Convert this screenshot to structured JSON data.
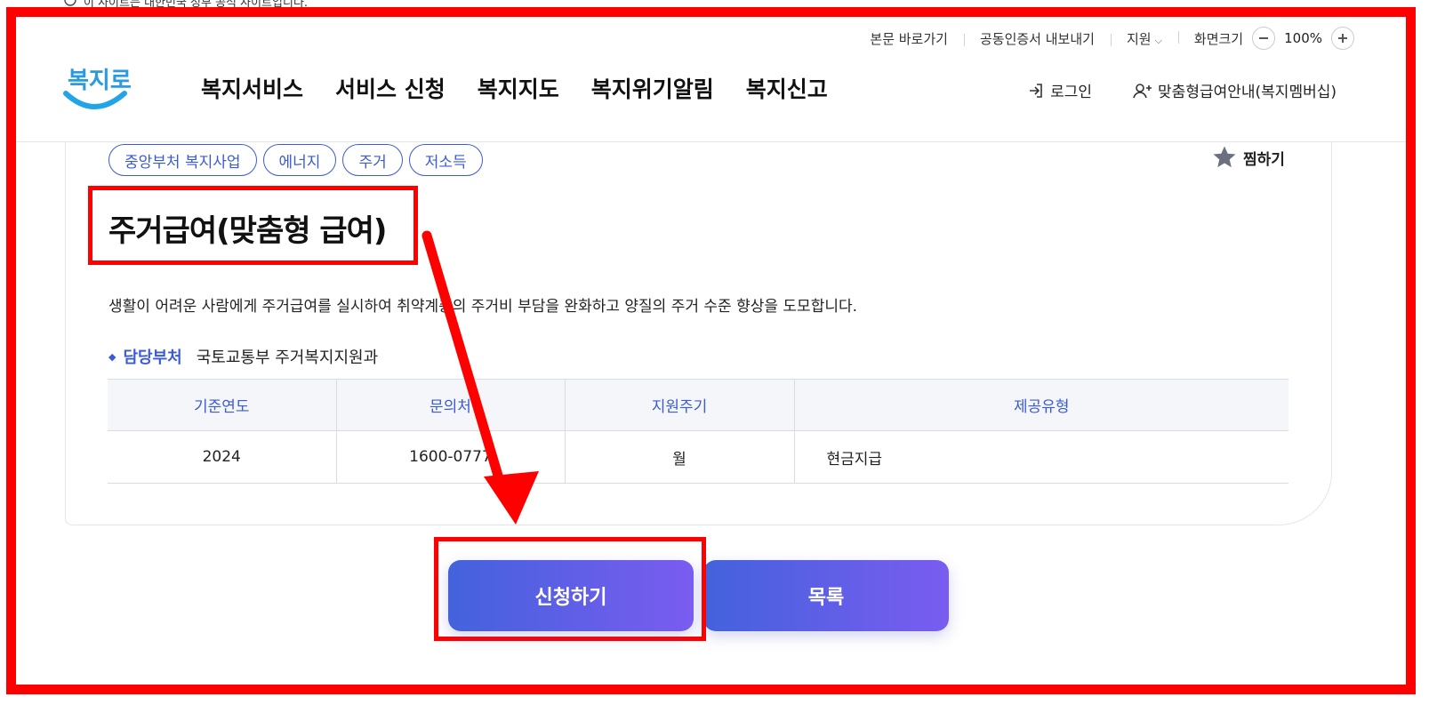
{
  "top_banner": {
    "text": "이 사이트는 대한민국 정부 공식 사이트입니다."
  },
  "header": {
    "utility": {
      "skip_link": "본문 바로가기",
      "cert_export": "공동인증서 내보내기",
      "support": "지원",
      "zoom_label": "화면크기",
      "zoom_value": "100%"
    },
    "logo_text": "복지로",
    "gnb": [
      "복지서비스",
      "서비스 신청",
      "복지지도",
      "복지위기알림",
      "복지신고"
    ],
    "login": "로그인",
    "membership": "맞춤형급여안내(복지멤버십)"
  },
  "service": {
    "tags": [
      "중앙부처 복지사업",
      "에너지",
      "주거",
      "저소득"
    ],
    "bookmark": "찜하기",
    "title": "주거급여(맞춤형 급여)",
    "description": "생활이 어려운 사람에게 주거급여를 실시하여 취약계층의 주거비 부담을 완화하고 양질의 주거 수준 향상을 도모합니다.",
    "dept_label": "담당부처",
    "dept_value": "국토교통부 주거복지지원과",
    "table": {
      "headers": [
        "기준연도",
        "문의처",
        "지원주기",
        "제공유형"
      ],
      "row": [
        "2024",
        "1600-0777",
        "월",
        "현금지급"
      ]
    }
  },
  "actions": {
    "apply": "신청하기",
    "list": "목록"
  },
  "colors": {
    "accent": "#3b5bd6",
    "annotation": "#ff0000",
    "gradient_end": "#7a5cf0"
  }
}
